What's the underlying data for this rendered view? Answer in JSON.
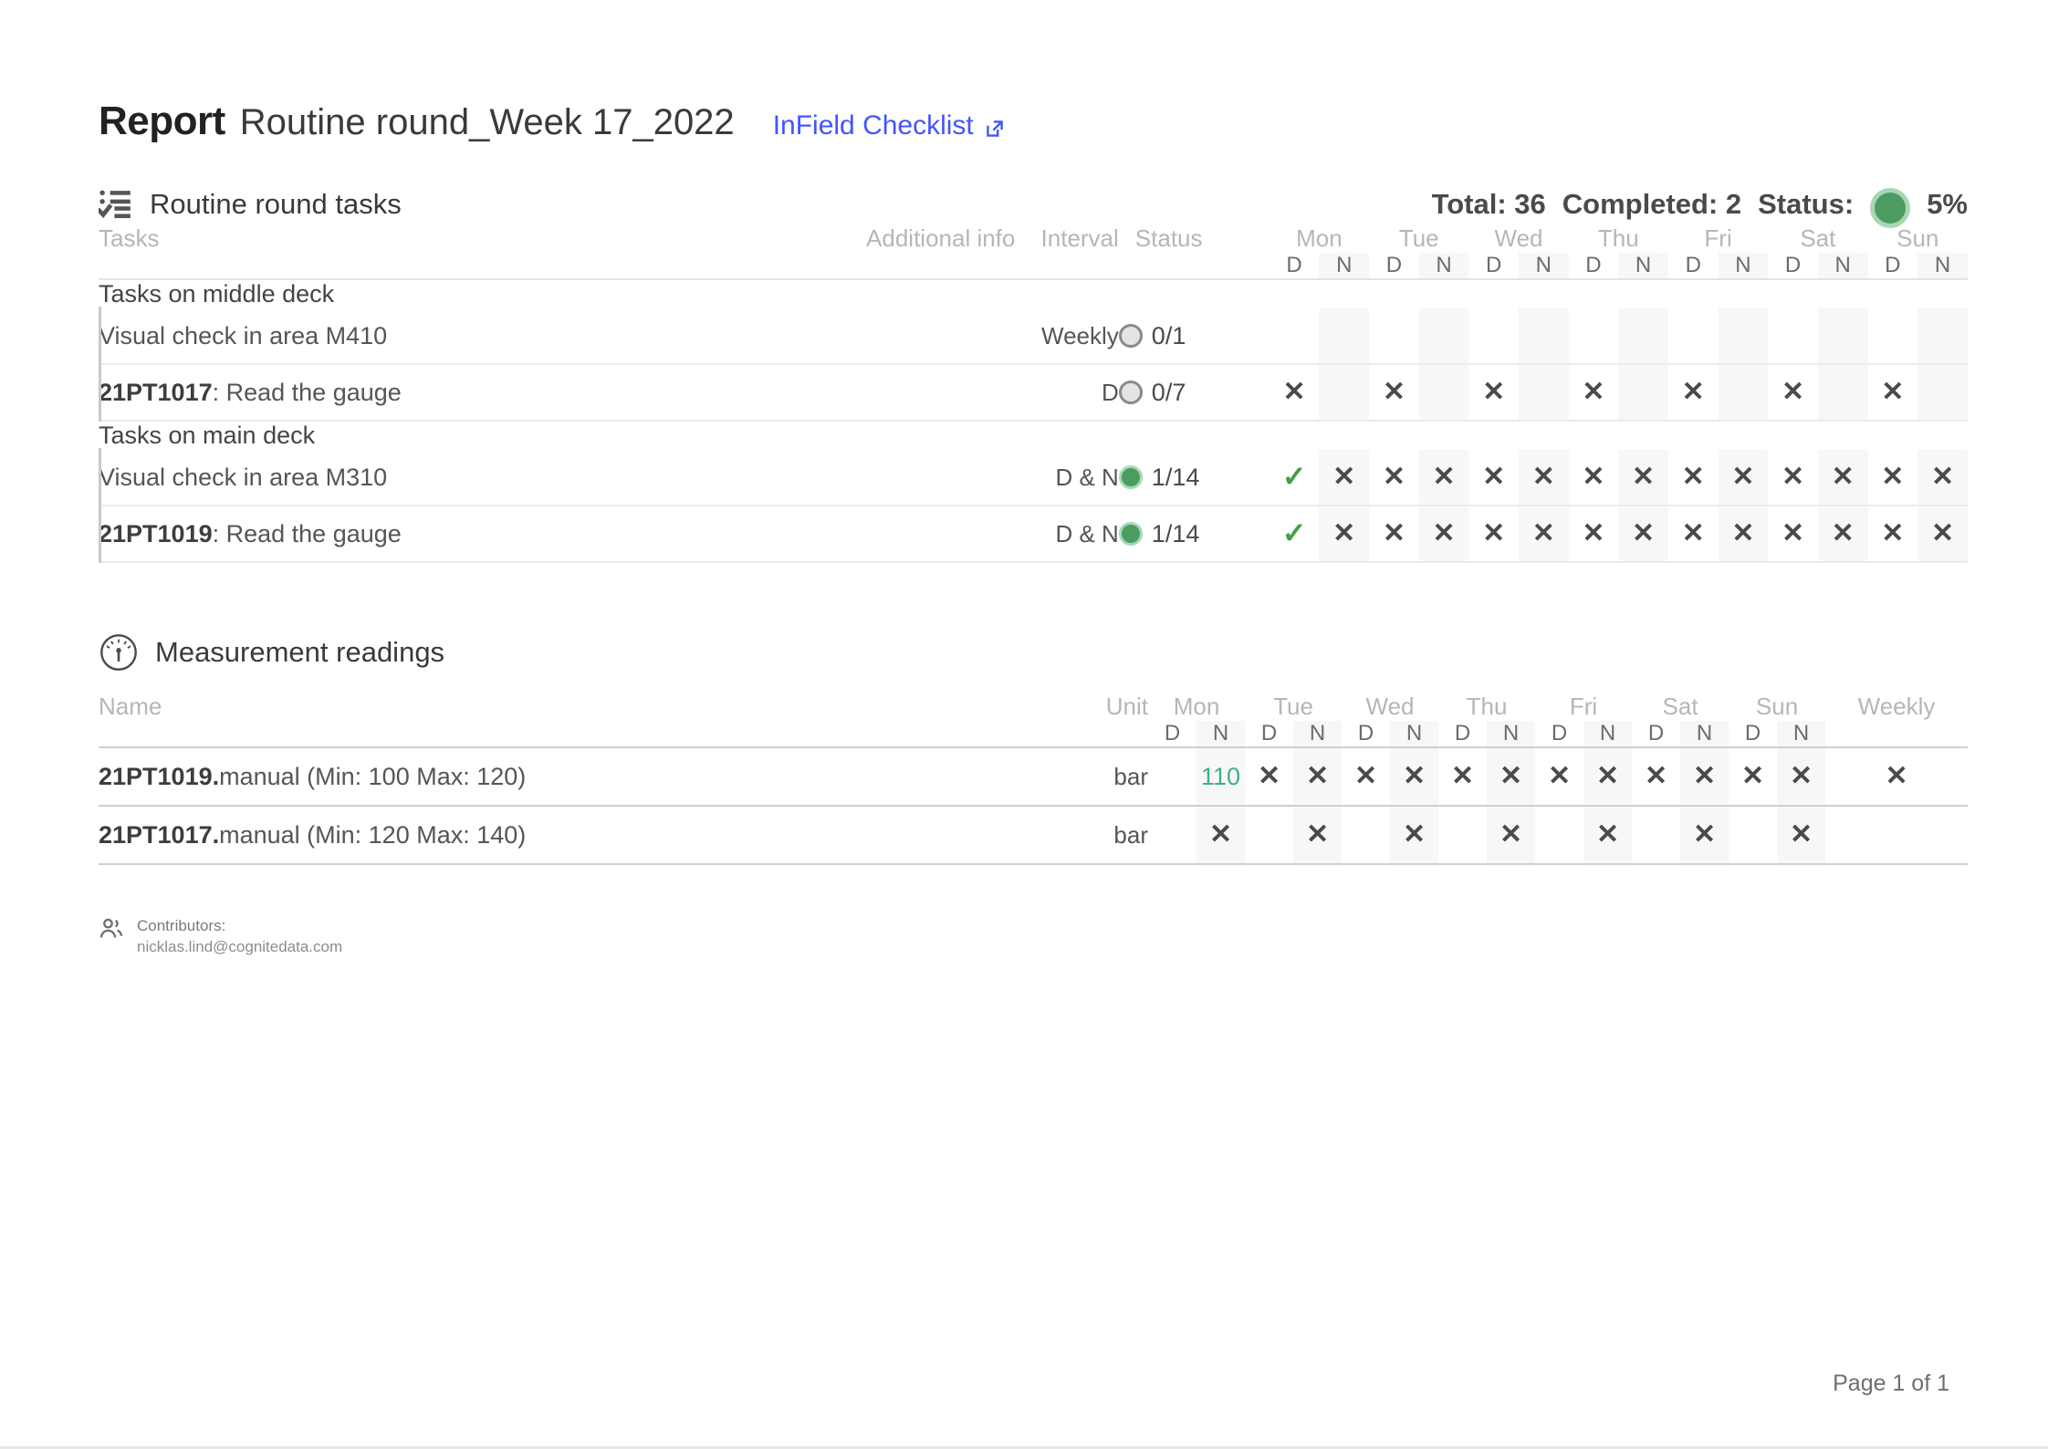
{
  "report": {
    "label": "Report",
    "name": "Routine round_Week 17_2022",
    "link_text": "InField Checklist",
    "link_icon": "external-link-icon"
  },
  "tasks_section": {
    "icon": "checklist-icon",
    "title": "Routine round tasks",
    "stats": {
      "total_label": "Total: 36",
      "completed_label": "Completed: 2",
      "status_label": "Status:",
      "status_percent": "5%",
      "status_color": "#4c9c62"
    },
    "columns": {
      "tasks": "Tasks",
      "additional_info": "Additional info",
      "interval": "Interval",
      "status": "Status"
    },
    "days": [
      "Mon",
      "Tue",
      "Wed",
      "Thu",
      "Fri",
      "Sat",
      "Sun"
    ],
    "shifts": [
      "D",
      "N"
    ],
    "groups": [
      {
        "title": "Tasks on middle deck",
        "rows": [
          {
            "tag": "",
            "name": "Visual check in area M410",
            "additional_info": "",
            "interval": "Weekly",
            "status_dot": "grey",
            "status_text": "0/1",
            "cells": [
              "",
              "",
              "",
              "",
              "",
              "",
              "",
              "",
              "",
              "",
              "",
              "",
              "",
              ""
            ]
          },
          {
            "tag": "21PT1017",
            "name": ": Read the gauge",
            "additional_info": "",
            "interval": "D",
            "status_dot": "grey",
            "status_text": "0/7",
            "cells": [
              "x",
              "",
              "x",
              "",
              "x",
              "",
              "x",
              "",
              "x",
              "",
              "x",
              "",
              "x",
              ""
            ]
          }
        ]
      },
      {
        "title": "Tasks on main deck",
        "rows": [
          {
            "tag": "",
            "name": "Visual check in area M310",
            "additional_info": "",
            "interval": "D & N",
            "status_dot": "green",
            "status_text": "1/14",
            "cells": [
              "check",
              "x",
              "x",
              "x",
              "x",
              "x",
              "x",
              "x",
              "x",
              "x",
              "x",
              "x",
              "x",
              "x"
            ]
          },
          {
            "tag": "21PT1019",
            "name": ": Read the gauge",
            "additional_info": "",
            "interval": "D & N",
            "status_dot": "green",
            "status_text": "1/14",
            "cells": [
              "check",
              "x",
              "x",
              "x",
              "x",
              "x",
              "x",
              "x",
              "x",
              "x",
              "x",
              "x",
              "x",
              "x"
            ]
          }
        ]
      }
    ]
  },
  "measurements_section": {
    "icon": "gauge-icon",
    "title": "Measurement readings",
    "columns": {
      "name": "Name",
      "unit": "Unit",
      "weekly": "Weekly"
    },
    "days": [
      "Mon",
      "Tue",
      "Wed",
      "Thu",
      "Fri",
      "Sat",
      "Sun"
    ],
    "shifts": [
      "D",
      "N"
    ],
    "rows": [
      {
        "tag": "21PT1019.",
        "name": "manual (Min: 100 Max: 120)",
        "unit": "bar",
        "cells": [
          "",
          "110",
          "x",
          "x",
          "x",
          "x",
          "x",
          "x",
          "x",
          "x",
          "x",
          "x",
          "x",
          "x"
        ],
        "weekly": "x"
      },
      {
        "tag": "21PT1017.",
        "name": "manual (Min: 120 Max: 140)",
        "unit": "bar",
        "cells": [
          "",
          "x",
          "",
          "x",
          "",
          "x",
          "",
          "x",
          "",
          "x",
          "",
          "x",
          "",
          "x"
        ],
        "weekly": ""
      }
    ]
  },
  "footer": {
    "icon": "people-icon",
    "contributors_label": "Contributors:",
    "contributors_value": "nicklas.lind@cognitedata.com",
    "page_label": "Page 1 of 1"
  }
}
